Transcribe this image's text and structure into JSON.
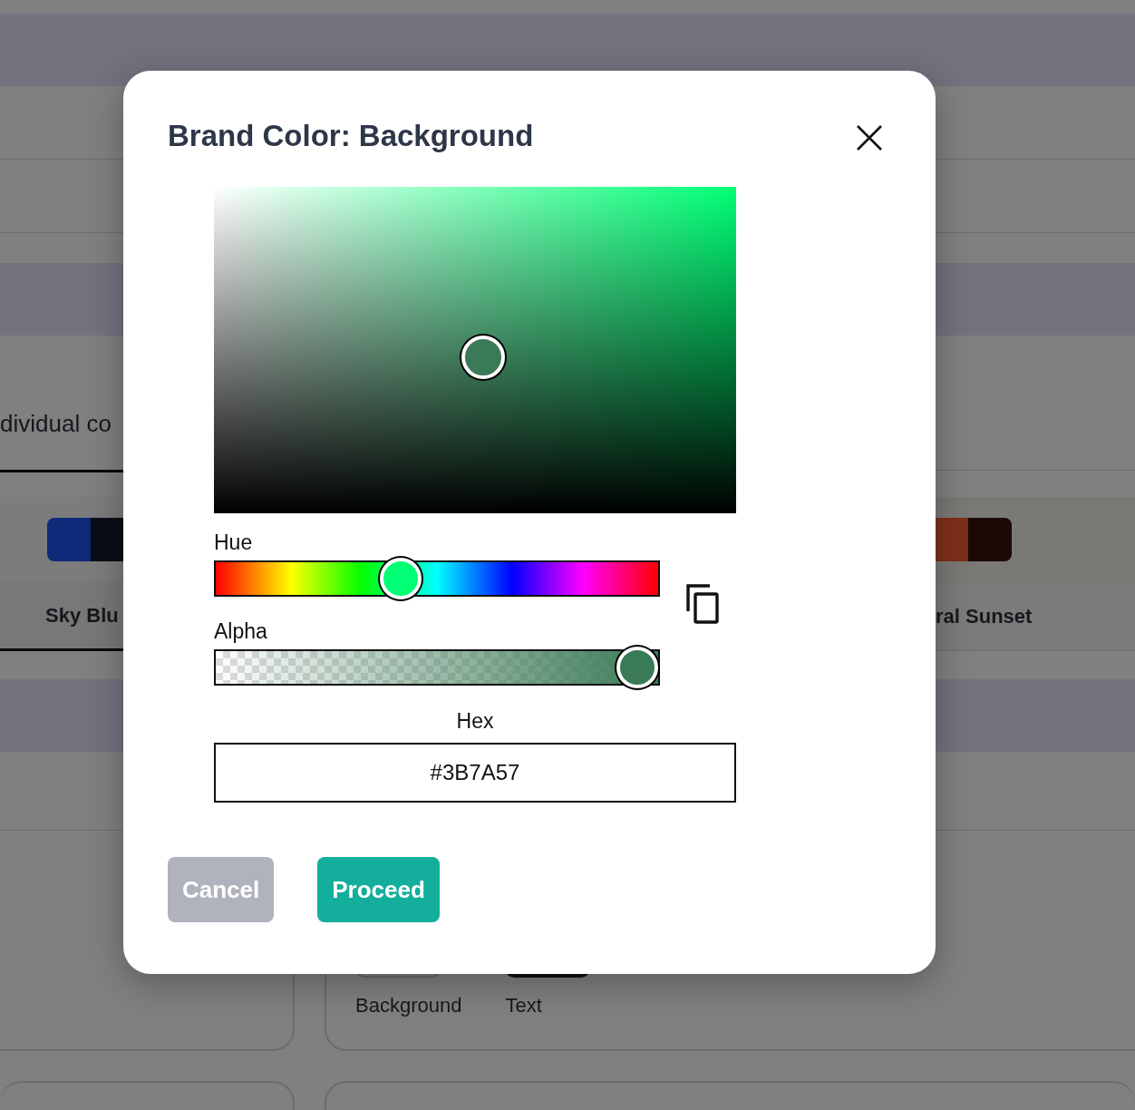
{
  "page": {
    "tabs": [
      {
        "label": "dividual co",
        "selected": true
      }
    ],
    "palettes": [
      {
        "name": "Sky Blu",
        "selected": true,
        "swatches": [
          {
            "color": "#0f2a78"
          },
          {
            "color": "#090d15"
          }
        ]
      },
      {
        "name": "ral Sunset",
        "selected": false,
        "swatches": [
          {
            "color": "#7f2f19"
          },
          {
            "color": "#1c0a04"
          }
        ]
      }
    ],
    "color_roles": [
      {
        "label": "Background",
        "kind": "outlined"
      },
      {
        "label": "Text",
        "kind": "filled"
      }
    ]
  },
  "dialog": {
    "title": "Brand Color: Background",
    "picker": {
      "hue": {
        "label": "Hue",
        "level": 0.41
      },
      "alpha": {
        "label": "Alpha",
        "level": 1
      },
      "hex": {
        "label": "Hex",
        "value": "#3B7A57"
      }
    },
    "buttons": [
      {
        "label": "Cancel",
        "disabled": true
      },
      {
        "label": "Proceed",
        "disabled": false
      }
    ]
  }
}
